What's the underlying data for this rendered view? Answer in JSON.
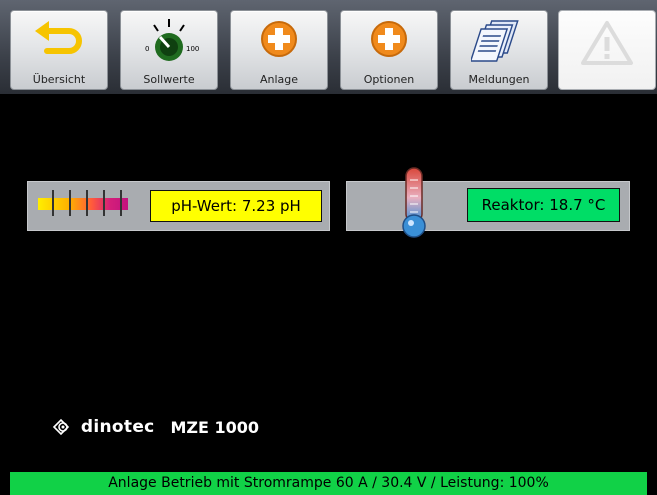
{
  "toolbar": {
    "buttons": [
      {
        "label": "Übersicht",
        "icon": "back-arrow-icon"
      },
      {
        "label": "Sollwerte",
        "icon": "dial-icon",
        "dial_min": "0",
        "dial_max": "100"
      },
      {
        "label": "Anlage",
        "icon": "plus-icon"
      },
      {
        "label": "Optionen",
        "icon": "plus-icon"
      },
      {
        "label": "Meldungen",
        "icon": "documents-icon"
      },
      {
        "label": "",
        "icon": "warning-icon",
        "disabled": true
      }
    ]
  },
  "ph_panel": {
    "display": "pH-Wert: 7.23 pH",
    "color": "#ffff00"
  },
  "temp_panel": {
    "display": "Reaktor: 18.7 °C",
    "color": "#00dd66"
  },
  "brand": {
    "name": "dinotec",
    "model": "MZE 1000"
  },
  "status": {
    "text": "Anlage Betrieb mit Stromrampe 60 A / 30.4 V / Leistung: 100%",
    "color": "#11d147"
  }
}
